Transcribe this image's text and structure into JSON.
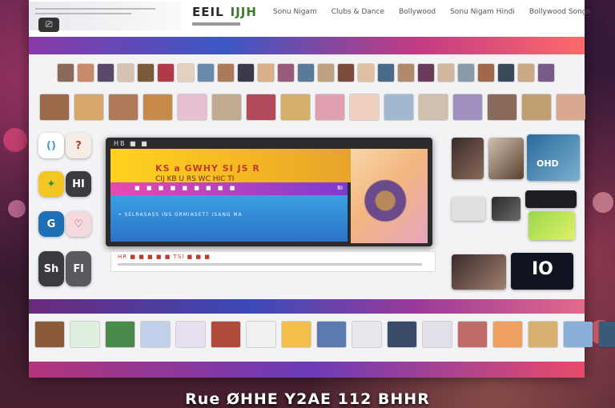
{
  "header": {
    "brand_primary": "EEIL",
    "brand_secondary": "IJJH",
    "nav_links": [
      "Sonu Nigam",
      "Clubs & Dance",
      "Bollywood",
      "Sonu Nigam Hindi",
      "Bollywood Songs"
    ]
  },
  "player": {
    "top_label": "HB ■ ■",
    "title": "KS a GWHY SI JS R",
    "subtitle": "CIJ KB U RS WC HIC TI",
    "purple_label": "■ ■ ■ ■ ■ ■ ■ ■ ■",
    "purple_right": "BI",
    "blue_text": "• SELRASASS INS GRMIASETT ISANG MA",
    "controls_text": "HR ■ ■ ■ ■ ■  TSI ■ ■ ■"
  },
  "app_icons": [
    {
      "icon": "clock-icon",
      "label": "()",
      "bg": "#ffffff",
      "fg": "#3a9bd5"
    },
    {
      "icon": "gesture-icon",
      "label": "?",
      "bg": "#f6eee6",
      "fg": "#c0392b"
    },
    {
      "icon": "leaf-icon",
      "label": "✦",
      "bg": "#f4c623",
      "fg": "#2f8f3a"
    },
    {
      "icon": "grid-icon",
      "label": "HI",
      "bg": "#3b3b3f",
      "fg": "#ffffff"
    },
    {
      "icon": "g-icon",
      "label": "G",
      "bg": "#1f6fb5",
      "fg": "#ffffff"
    },
    {
      "icon": "heart-icon",
      "label": "♡",
      "bg": "#f4d9de",
      "fg": "#c0392b"
    },
    {
      "icon": "letter-icon",
      "label": "Sh",
      "bg": "#3b3b3f",
      "fg": "#ffffff"
    },
    {
      "icon": "script-icon",
      "label": "Fl",
      "bg": "#5a5a5e",
      "fg": "#ffffff"
    }
  ],
  "right_tiles": {
    "tile_text": "OHD",
    "big_text": "IO"
  },
  "bottom_caption": "Rue ØHHE Y2AE 112 BHHR",
  "colors": {
    "accent_yellow": "#ffd21f",
    "accent_purple": "#7b3bd0",
    "accent_blue": "#2b72c8",
    "accent_pink": "#e84bb0"
  }
}
